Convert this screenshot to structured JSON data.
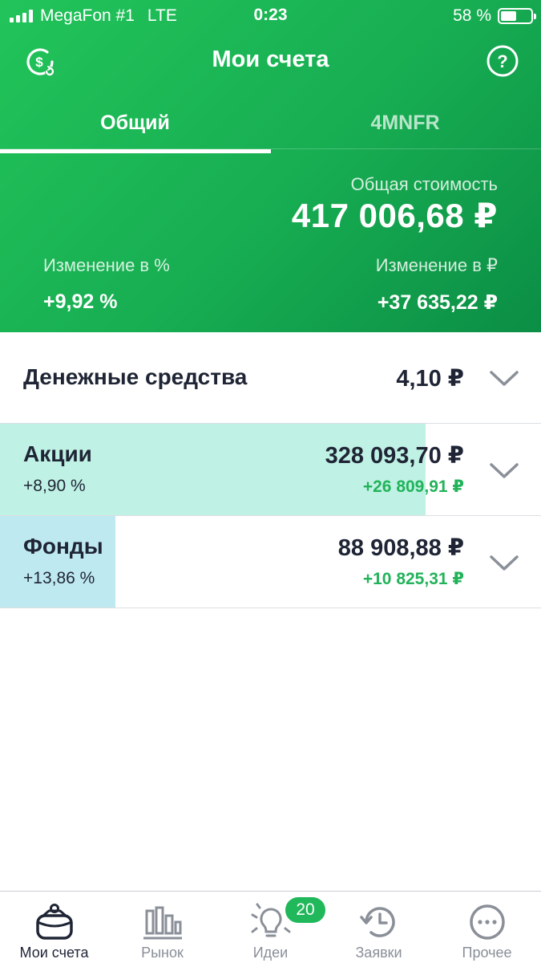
{
  "status_bar": {
    "carrier": "MegaFon #1",
    "network": "LTE",
    "time": "0:23",
    "battery_percent": "58 %",
    "battery_level": 0.58
  },
  "nav": {
    "title": "Мои счета",
    "left_icon": "dollar-refresh-icon",
    "right_icon": "help-icon"
  },
  "tabs": [
    {
      "label": "Общий",
      "active": true
    },
    {
      "label": "4MNFR",
      "active": false
    }
  ],
  "summary": {
    "total_label": "Общая стоимость",
    "total_value": "417 006,68 ₽",
    "change_pct_label": "Изменение в %",
    "change_pct_value": "+9,92 %",
    "change_rub_label": "Изменение в ₽",
    "change_rub_value": "+37 635,22 ₽"
  },
  "assets": [
    {
      "name": "Денежные средства",
      "amount": "4,10 ₽",
      "pct": "",
      "delta": "",
      "share": 0,
      "bar_color": ""
    },
    {
      "name": "Акции",
      "amount": "328 093,70 ₽",
      "pct": "+8,90 %",
      "delta": "+26 809,91 ₽",
      "share": 0.787,
      "bar_color": "#bff1e4"
    },
    {
      "name": "Фонды",
      "amount": "88 908,88 ₽",
      "pct": "+13,86 %",
      "delta": "+10 825,31 ₽",
      "share": 0.213,
      "bar_color": "#bfe9f0"
    }
  ],
  "tabbar": {
    "items": [
      {
        "label": "Мои счета",
        "icon": "wallet-icon",
        "active": true
      },
      {
        "label": "Рынок",
        "icon": "market-chart-icon",
        "active": false
      },
      {
        "label": "Идеи",
        "icon": "lightbulb-icon",
        "active": false
      },
      {
        "label": "Заявки",
        "icon": "history-clock-icon",
        "active": false
      },
      {
        "label": "Прочее",
        "icon": "more-dots-icon",
        "active": false
      }
    ],
    "ideas_badge": "20"
  },
  "colors": {
    "header_green": "#1bb354",
    "positive_green": "#22b35a",
    "stocks_bar": "#bff1e4",
    "funds_bar": "#bfe9f0"
  }
}
